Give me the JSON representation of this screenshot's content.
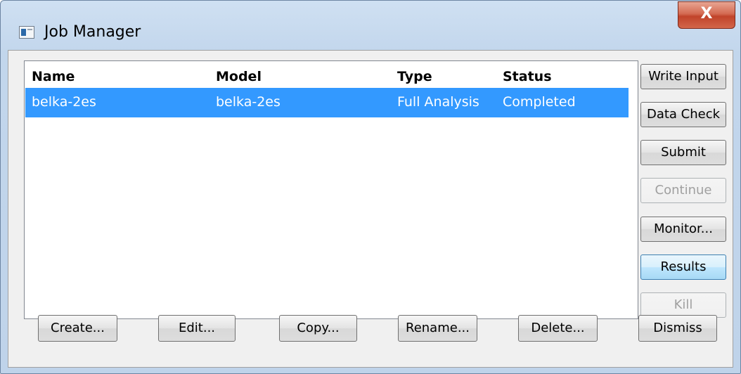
{
  "window": {
    "title": "Job Manager",
    "close_label": "X"
  },
  "jobs_list": {
    "columns": [
      "Name",
      "Model",
      "Type",
      "Status"
    ],
    "rows": [
      {
        "name": "belka-2es",
        "model": "belka-2es",
        "type": "Full Analysis",
        "status": "Completed",
        "selected": true
      }
    ],
    "selection_color": "#3399ff"
  },
  "side_buttons": [
    {
      "label": "Write Input",
      "enabled": true
    },
    {
      "label": "Data Check",
      "enabled": true
    },
    {
      "label": "Submit",
      "enabled": true
    },
    {
      "label": "Continue",
      "enabled": false
    },
    {
      "label": "Monitor...",
      "enabled": true
    },
    {
      "label": "Results",
      "enabled": true
    },
    {
      "label": "Kill",
      "enabled": false
    }
  ],
  "bottom_buttons": [
    {
      "label": "Create..."
    },
    {
      "label": "Edit..."
    },
    {
      "label": "Copy..."
    },
    {
      "label": "Rename..."
    },
    {
      "label": "Delete..."
    },
    {
      "label": "Dismiss"
    }
  ]
}
